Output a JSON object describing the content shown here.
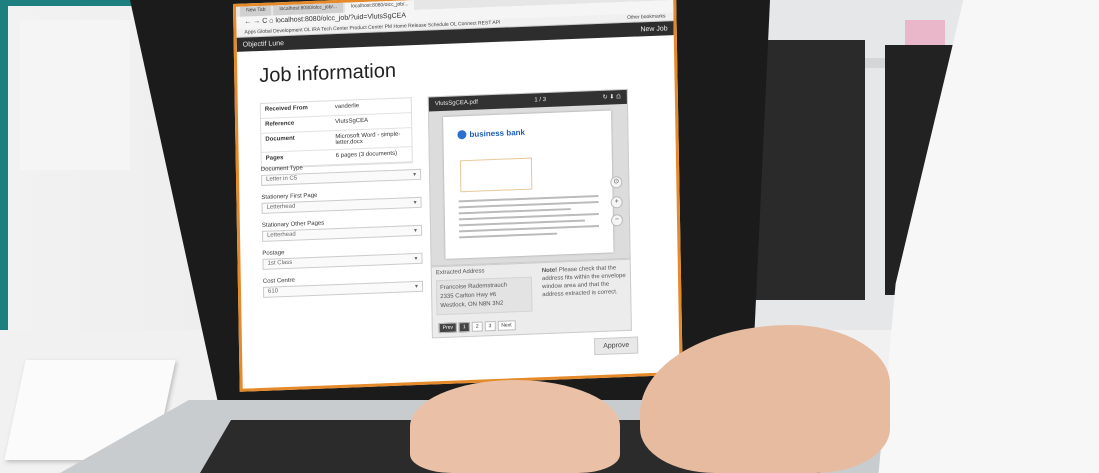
{
  "browser": {
    "tabs": [
      "New Tab",
      "localhost:8080/olcc_job/...",
      "localhost:8080/olcc_job/..."
    ],
    "address": "localhost:8080/olcc_job/?uid=VlutsSgCEA",
    "bookmarks": "Apps  Global Development  OL IRA  Tech Center  Product Center  PM Home  Release Schedule  OL Connect REST API",
    "other_bookmarks": "Other bookmarks"
  },
  "app": {
    "brand": "Objectif Lune",
    "new_job": "New Job"
  },
  "job": {
    "title": "Job information",
    "info": [
      {
        "key": "Received From",
        "value": "vanderlie"
      },
      {
        "key": "Reference",
        "value": "VlutsSgCEA"
      },
      {
        "key": "Document",
        "value": "Microsoft Word - simple-letter.docx"
      },
      {
        "key": "Pages",
        "value": "6 pages (3 documents)"
      }
    ],
    "fields": [
      {
        "label": "Document Type",
        "value": "Letter in C5"
      },
      {
        "label": "Stationery First Page",
        "value": "Letterhead"
      },
      {
        "label": "Stationary Other Pages",
        "value": "Letterhead"
      },
      {
        "label": "Postage",
        "value": "1st Class"
      },
      {
        "label": "Cost Centre",
        "value": "610"
      }
    ]
  },
  "viewer": {
    "filename": "VlutsSgCEA.pdf",
    "page_counter": "1 / 3",
    "logo_text": "business bank"
  },
  "extract": {
    "label": "Extracted Address",
    "address_lines": [
      "Francoise Rademstrauch",
      "2335 Carlton Hwy #6",
      "Westlock, ON N8N 3N2"
    ],
    "note_bold": "Note!",
    "note_text": "Please check that the address fits within the envelope window area and that the address extracted is correct."
  },
  "pager": {
    "prev": "Prev",
    "pages": [
      "1",
      "2",
      "3"
    ],
    "next": "Next"
  },
  "approve_label": "Approve"
}
